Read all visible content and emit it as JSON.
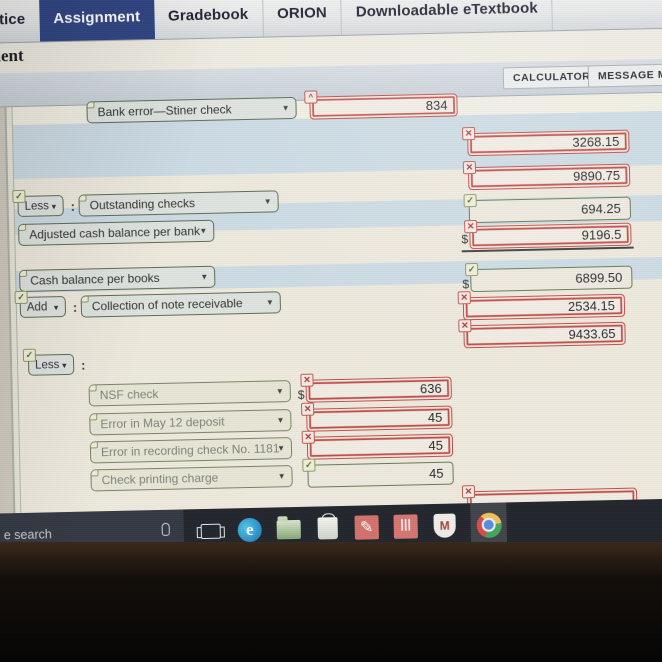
{
  "browser": {
    "tabs": [
      {
        "label": "ctice",
        "active": false
      },
      {
        "label": "Assignment",
        "active": true
      },
      {
        "label": "Gradebook",
        "active": false
      },
      {
        "label": "ORION",
        "active": false
      },
      {
        "label": "Downloadable eTextbook",
        "active": false
      }
    ]
  },
  "page": {
    "heading": "nment"
  },
  "toolbar": {
    "calculator_label": "CALCULATOR",
    "message_label": "MESSAGE MY IN"
  },
  "symbols": {
    "caret_down": "▼",
    "caret_up": "^",
    "check": "✓",
    "cross": "✕",
    "colon": ":",
    "dollar": "$"
  },
  "colors": {
    "tab_active_bg": "#27408b",
    "correct_outline": "#566b4a",
    "incorrect_outline": "#d0453f",
    "band_blue": "#c9dbe6",
    "band_cream": "#efeadb"
  },
  "form": {
    "rows": [
      {
        "id": "bank-error-stiner",
        "label": "Bank error—Stiner check",
        "label_status": "correct",
        "amount": "834",
        "amount_status": "incorrect",
        "badge": "caret"
      },
      {
        "id": "amount-3268",
        "label": null,
        "amount": "3268.15",
        "amount_status": "incorrect"
      },
      {
        "id": "amount-9890",
        "label": null,
        "amount": "9890.75",
        "amount_status": "incorrect"
      },
      {
        "id": "outstanding-checks",
        "operator": "Less",
        "operator_status": "correct",
        "label": "Outstanding checks",
        "label_status": "correct",
        "amount": "694.25",
        "amount_status": "correct"
      },
      {
        "id": "adjusted-cash-balance-bank",
        "label": "Adjusted cash balance per bank",
        "label_status": "correct",
        "amount": "9196.5",
        "amount_status": "incorrect",
        "prefix": "$",
        "total_rule": true
      },
      {
        "id": "cash-balance-books",
        "label": "Cash balance per books",
        "label_status": "correct",
        "amount": "6899.50",
        "amount_status": "correct",
        "prefix": "$"
      },
      {
        "id": "collection-note-receivable",
        "operator": "Add",
        "operator_status": "correct",
        "label": "Collection of note receivable",
        "label_status": "correct",
        "amount": "2534.15",
        "amount_status": "incorrect"
      },
      {
        "id": "subtotal-9433",
        "label": null,
        "amount": "9433.65",
        "amount_status": "incorrect"
      },
      {
        "id": "less-deductions",
        "operator": "Less",
        "operator_status": "correct",
        "label": null
      },
      {
        "id": "nsf-check",
        "label": "NSF check",
        "label_status": "correct",
        "amount": "636",
        "amount_status": "incorrect",
        "prefix": "$"
      },
      {
        "id": "error-may-12-deposit",
        "label": "Error in May 12 deposit",
        "label_status": "correct",
        "amount": "45",
        "amount_status": "incorrect"
      },
      {
        "id": "error-recording-check-1181",
        "label": "Error in recording check No. 1181",
        "label_status": "correct",
        "amount": "45",
        "amount_status": "incorrect"
      },
      {
        "id": "check-printing-charge",
        "label": "Check printing charge",
        "label_status": "correct",
        "amount": "45",
        "amount_status": "correct"
      },
      {
        "id": "adjusted-cash-balance-books",
        "label": null,
        "amount": "",
        "amount_status": "incorrect"
      }
    ]
  },
  "taskbar": {
    "search_placeholder": "e search",
    "items": [
      {
        "name": "cortana-mic-icon"
      },
      {
        "name": "task-view-icon"
      },
      {
        "name": "edge-icon",
        "glyph": "e"
      },
      {
        "name": "file-explorer-icon"
      },
      {
        "name": "microsoft-store-icon"
      },
      {
        "name": "app-red-1-icon",
        "glyph": "✎"
      },
      {
        "name": "app-red-2-icon",
        "glyph": "lll"
      },
      {
        "name": "mcafee-shield-icon",
        "glyph": "M"
      },
      {
        "name": "chrome-icon"
      }
    ]
  }
}
